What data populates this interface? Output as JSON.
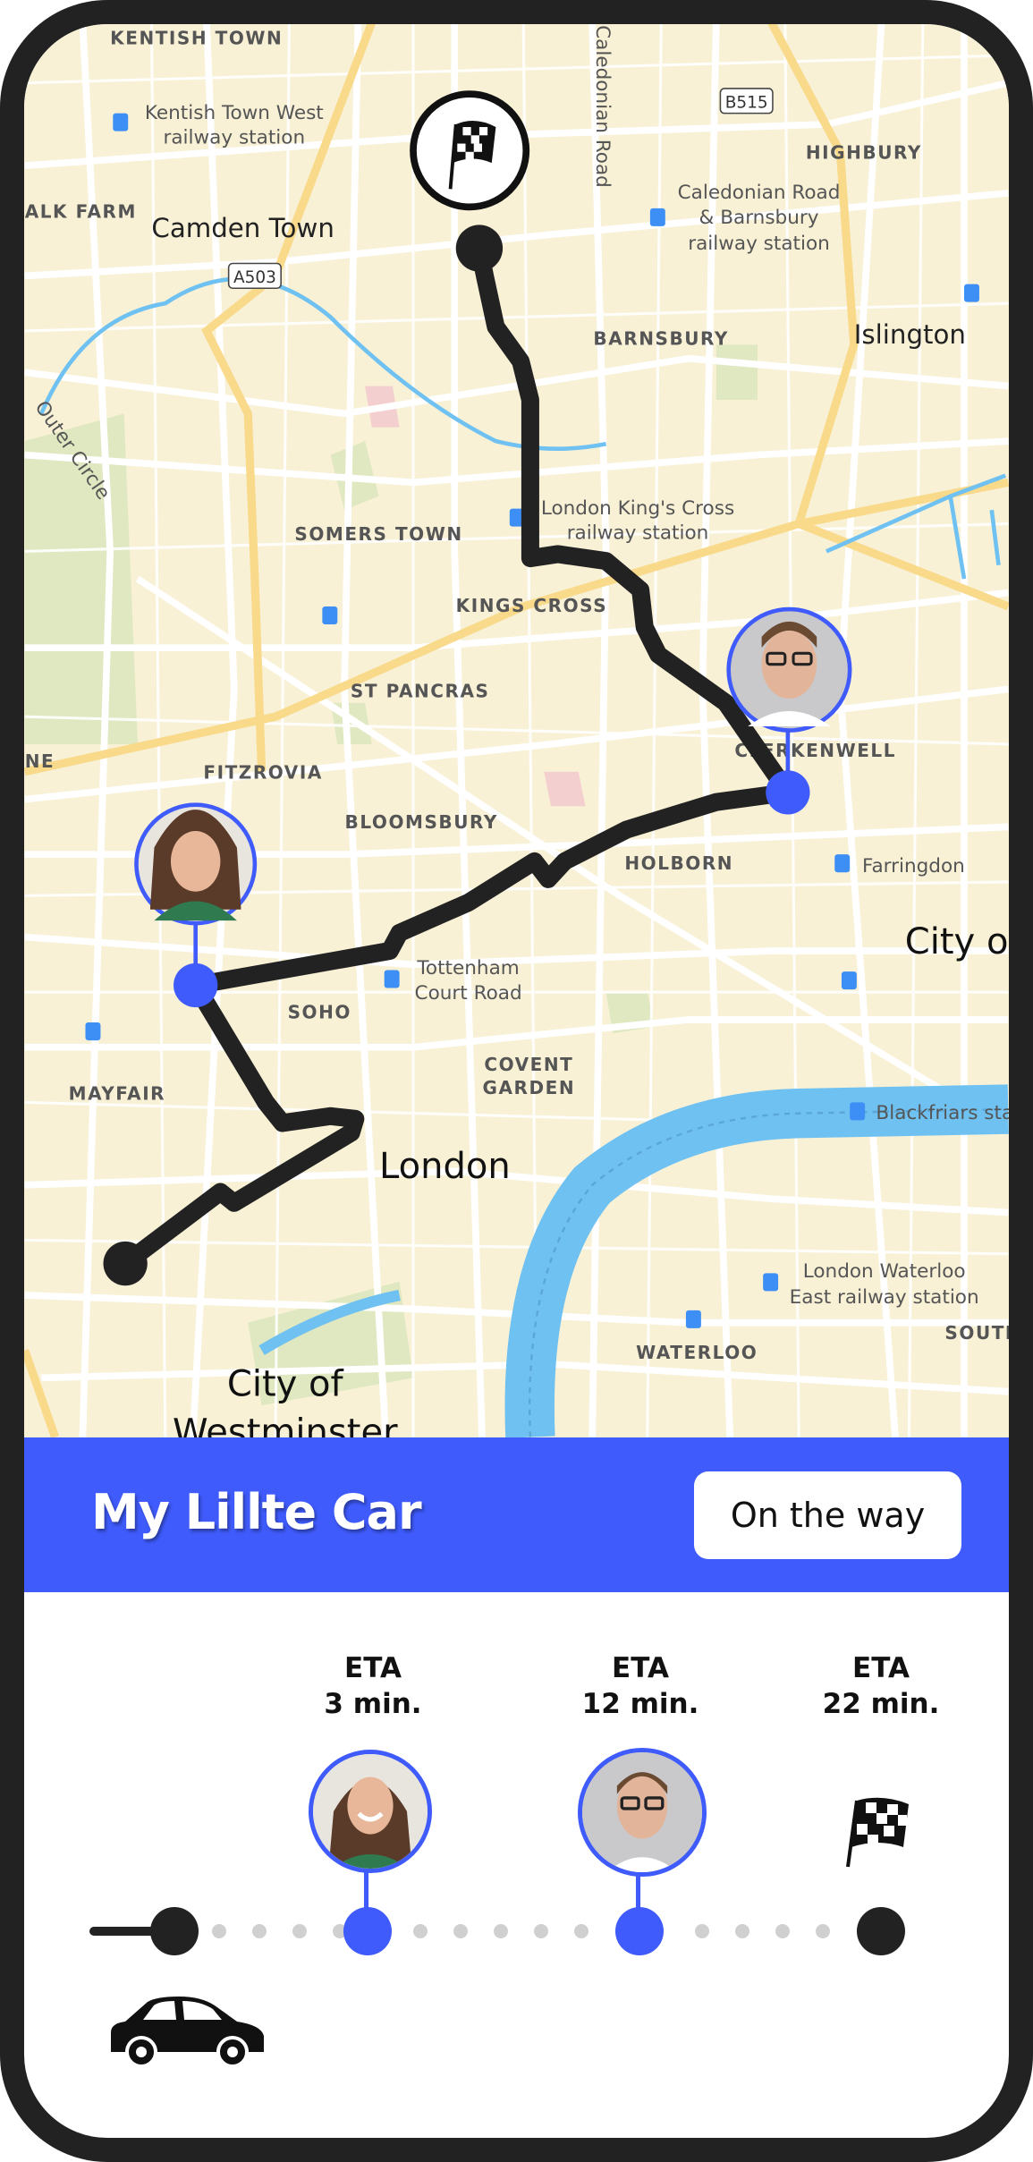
{
  "map": {
    "labels": {
      "kentish_town": "KENTISH TOWN",
      "kentish_town_west_1": "Kentish Town West",
      "kentish_town_west_2": "railway station",
      "highbury": "HIGHBURY",
      "chalk_farm": "ALK FARM",
      "camden_town": "Camden Town",
      "caledonian_1": "Caledonian Road",
      "caledonian_2": "& Barnsbury",
      "caledonian_3": "railway station",
      "a503": "A503",
      "b515": "B515",
      "caledonian_road": "Caledonian Road",
      "islington": "Islington",
      "barnsbury": "BARNSBURY",
      "outer_circle": "Outer Circle",
      "kings_cross_station_1": "London King's Cross",
      "kings_cross_station_2": "railway station",
      "somers_town": "SOMERS TOWN",
      "kings_cross": "KINGS CROSS",
      "st_pancras": "ST PANCRAS",
      "clerkenwell": "CLERKENWELL",
      "fitzrovia": "FITZROVIA",
      "bloomsbury": "BLOOMSBURY",
      "holborn": "HOLBORN",
      "farringdon": "Farringdon",
      "city_of_london": "City o",
      "tottenham_1": "Tottenham",
      "tottenham_2": "Court Road",
      "soho": "SOHO",
      "covent_1": "COVENT",
      "covent_2": "GARDEN",
      "mayfair": "MAYFAIR",
      "blackfriars": "Blackfriars sta",
      "london": "London",
      "waterloo_east_1": "London Waterloo",
      "waterloo_east_2": "East railway station",
      "south": "SOUTH",
      "waterloo": "WATERLOO",
      "westminster_1": "City of",
      "westminster_2": "Westminster",
      "ne": "NE"
    },
    "colors": {
      "land": "#f8f1d6",
      "road": "#ffffff",
      "major_road": "#f9d98a",
      "water": "#6fc1f1",
      "park": "#dfe8c0",
      "route": "#222222"
    }
  },
  "header": {
    "title": "My Lillte Car",
    "status_button": "On the way"
  },
  "timeline": {
    "stops": [
      {
        "eta_label": "ETA",
        "eta_value": "3 min.",
        "type": "passenger-female"
      },
      {
        "eta_label": "ETA",
        "eta_value": "12 min.",
        "type": "passenger-male"
      },
      {
        "eta_label": "ETA",
        "eta_value": "22 min.",
        "type": "destination-flag"
      }
    ],
    "accent": "#3f5bfb"
  }
}
